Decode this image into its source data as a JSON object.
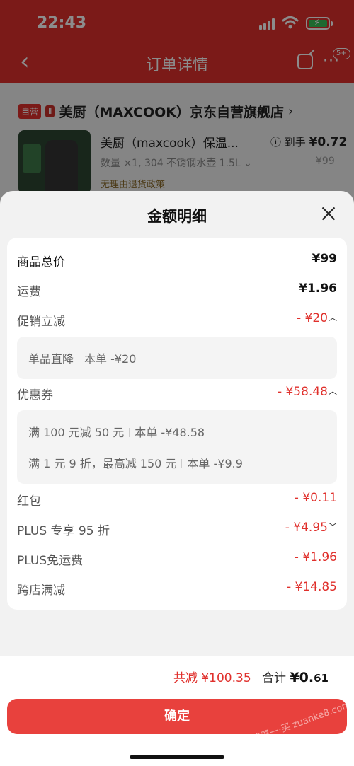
{
  "status_bar": {
    "time": "22:43"
  },
  "nav": {
    "back": "‹",
    "title": "订单详情",
    "more": "···",
    "badge": "5+"
  },
  "shop": {
    "tag_self": "自营",
    "logo_tag": "Ⅱ",
    "name": "美厨（MAXCOOK）京东自营旗舰店",
    "arrow": "›"
  },
  "product": {
    "name": "美厨（maxcook）保温...",
    "spec": "数量 ×1, 304 不锈钢水壶 1.5L ⌄",
    "return_policy": "无理由退货政策",
    "price_label": "ⓘ 到手",
    "price_value": "¥0.72",
    "original_price": "¥99"
  },
  "sheet": {
    "title": "金额明细",
    "rows": {
      "total_price": {
        "label": "商品总价",
        "value": "¥99"
      },
      "shipping": {
        "label": "运费",
        "value": "¥1.96"
      },
      "promo": {
        "label": "促销立减",
        "value": "- ¥20"
      },
      "promo_detail": {
        "name": "单品直降",
        "desc": "本单 -¥20"
      },
      "coupon": {
        "label": "优惠券",
        "value": "- ¥58.48"
      },
      "coupon_detail_1": {
        "name": "满 100 元减 50 元",
        "desc": "本单 -¥48.58"
      },
      "coupon_detail_2": {
        "name": "满 1 元 9 折，最高减 150 元",
        "desc": "本单 -¥9.9"
      },
      "red_packet": {
        "label": "红包",
        "value": "- ¥0.11"
      },
      "plus_discount": {
        "label": "PLUS 专享 95 折",
        "value": "- ¥4.95"
      },
      "plus_shipping": {
        "label": "PLUS免运费",
        "value": "- ¥1.96"
      },
      "cross_store": {
        "label": "跨店满减",
        "value": "- ¥14.85"
      }
    }
  },
  "footer": {
    "saved": "共减 ¥100.35",
    "sum_label": "合计",
    "sum_main": "¥0.",
    "sum_small": "61",
    "confirm": "确定"
  },
  "watermark": "值得一·买 zuanke8.com",
  "colors": {
    "accent": "#e0302c",
    "confirm": "#e8413d"
  }
}
